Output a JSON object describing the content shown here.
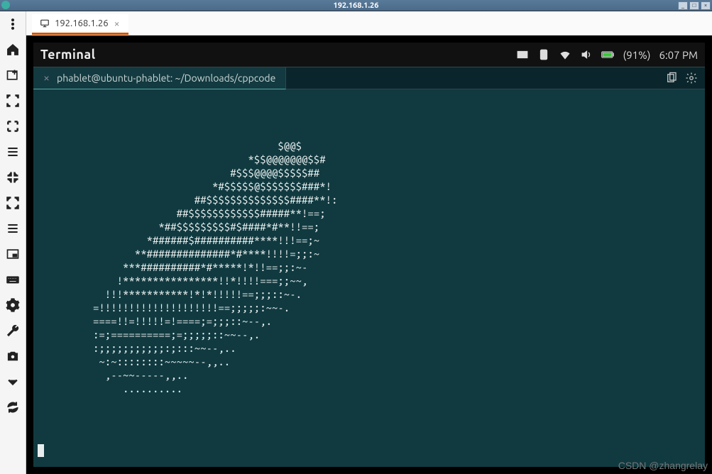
{
  "window": {
    "title": "192.168.1.26",
    "controls": {
      "min": "_",
      "max": "□",
      "close": "×"
    }
  },
  "sidebar": {
    "items": [
      {
        "name": "menu-dots",
        "semantic": "menu-icon"
      },
      {
        "name": "home",
        "semantic": "home-icon"
      },
      {
        "name": "new-window",
        "semantic": "new-window-icon"
      },
      {
        "name": "fullscreen-corners",
        "semantic": "fullscreen-icon"
      },
      {
        "name": "fullscreen",
        "semantic": "expand-icon"
      },
      {
        "name": "list-lines",
        "semantic": "menu-lines-icon"
      },
      {
        "name": "zoom-out-full",
        "semantic": "shrink-icon"
      },
      {
        "name": "zoom-in-full",
        "semantic": "stretch-icon"
      },
      {
        "name": "list-lines-2",
        "semantic": "menu-lines-icon"
      },
      {
        "name": "pip",
        "semantic": "pip-icon"
      },
      {
        "name": "keyboard",
        "semantic": "keyboard-icon"
      },
      {
        "name": "settings",
        "semantic": "gear-icon"
      },
      {
        "name": "wrench",
        "semantic": "wrench-icon"
      },
      {
        "name": "camera",
        "semantic": "camera-icon"
      },
      {
        "name": "collapse",
        "semantic": "chevron-down-icon"
      },
      {
        "name": "refresh",
        "semantic": "refresh-icon"
      }
    ]
  },
  "tab": {
    "icon": "monitor-icon",
    "label": "192.168.1.26",
    "close": "×"
  },
  "app": {
    "title": "Terminal",
    "battery_pct": "(91%)",
    "time": "6:07 PM"
  },
  "term_tab": {
    "label": "phablet@ubuntu-phablet: ~/Downloads/cppcode",
    "close": "×"
  },
  "ascii": "                                         $@@$\n                                    *$$@@@@@@@$$#\n                                 #$$$@@@@$$$$$##\n                              *#$$$$$@$$$$$$$###*!\n                           ##$$$$$$$$$$$$$$####**!:\n                        ##$$$$$$$$$$$$#####**!==;\n                     *##$$$$$$$$$#$####*#**!!==;\n                   *######$##########****!!!==;~\n                 **##############*#****!!!!=;;:~\n               ***##########*#*****!*!!==;;:~-\n              !****************!!*!!!!===;;~~,\n            !!!***********!*!*!!!!!==;;;::~-.\n          =!!!!!!!!!!!!!!!!!!!!==;;;;;:~~-.\n          ====!!=!!!!!=!====;=;;;::~--,.\n          :=;==========;=;;;;;::~~--,.\n          :;;;;;;;;;;;:;:::~~--,..\n           ~:~::::::::~~~~~--,,..\n            ,--~~-----,,..\n               ..........",
  "watermark": "CSDN @zhangrelay"
}
